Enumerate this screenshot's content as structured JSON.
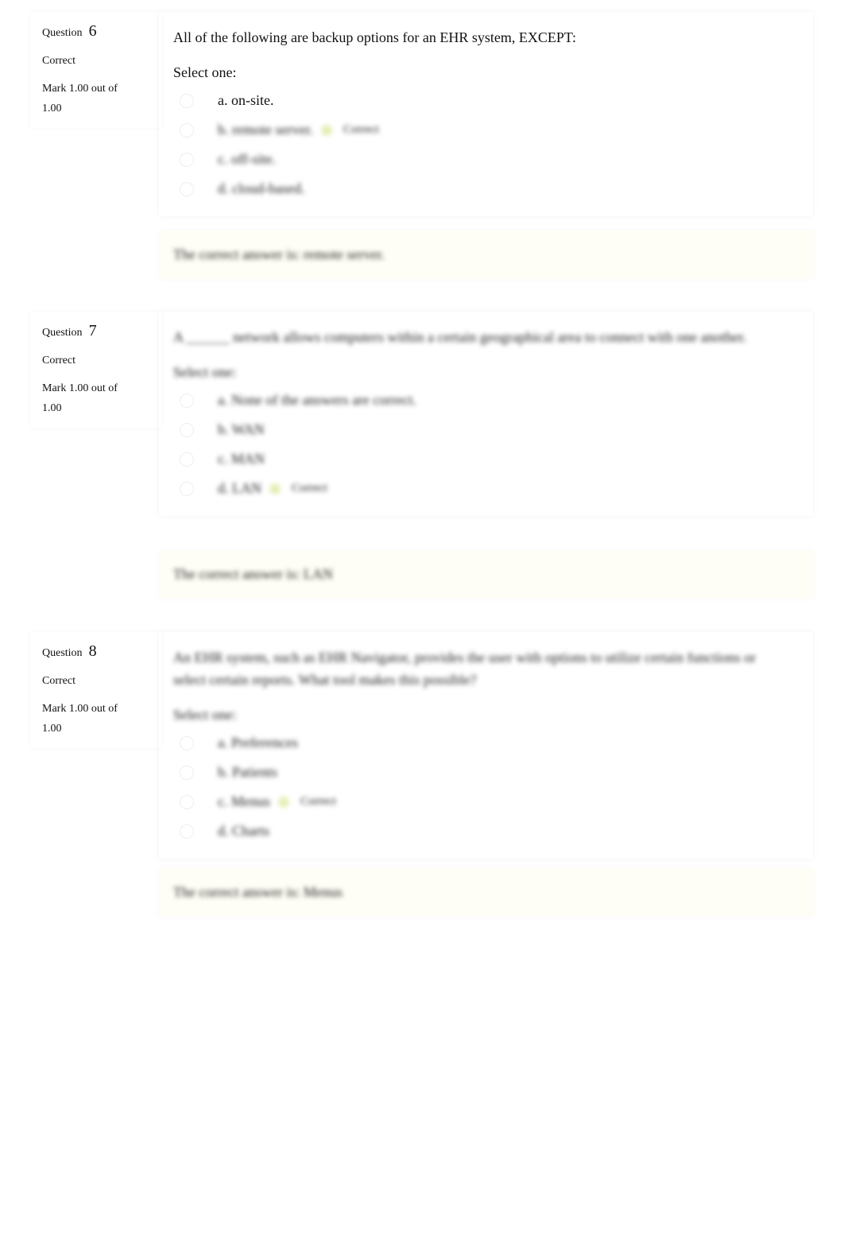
{
  "questions": [
    {
      "label": "Question",
      "number": "6",
      "state": "Correct",
      "mark": "Mark 1.00 out of 1.00",
      "text": "All of the following are backup options for an EHR system, EXCEPT:",
      "select": "Select one:",
      "options": [
        {
          "text": "a. on-site.",
          "correct": false
        },
        {
          "text": "b. remote server.",
          "correct": true
        },
        {
          "text": "c. off-site.",
          "correct": false
        },
        {
          "text": "d. cloud-based.",
          "correct": false
        }
      ],
      "correct_label": "Correct",
      "feedback": "The correct answer is: remote server."
    },
    {
      "label": "Question",
      "number": "7",
      "state": "Correct",
      "mark": "Mark 1.00 out of 1.00",
      "text": "A ______ network allows computers within a certain geographical area to connect with one another.",
      "select": "Select one:",
      "options": [
        {
          "text": "a. None of the answers are correct.",
          "correct": false
        },
        {
          "text": "b. WAN",
          "correct": false
        },
        {
          "text": "c. MAN",
          "correct": false
        },
        {
          "text": "d. LAN",
          "correct": true
        }
      ],
      "correct_label": "Correct",
      "feedback": "The correct answer is: LAN"
    },
    {
      "label": "Question",
      "number": "8",
      "state": "Correct",
      "mark": "Mark 1.00 out of 1.00",
      "text": "An EHR system, such as EHR Navigator, provides the user with options to utilize certain functions or select certain reports. What tool makes this possible?",
      "select": "Select one:",
      "options": [
        {
          "text": "a. Preferences",
          "correct": false
        },
        {
          "text": "b. Patients",
          "correct": false
        },
        {
          "text": "c. Menus",
          "correct": true
        },
        {
          "text": "d. Charts",
          "correct": false
        }
      ],
      "correct_label": "Correct",
      "feedback": "The correct answer is: Menus"
    }
  ],
  "colors": {
    "check": "#e6efb8",
    "feedback_bg": "#fffef6"
  }
}
